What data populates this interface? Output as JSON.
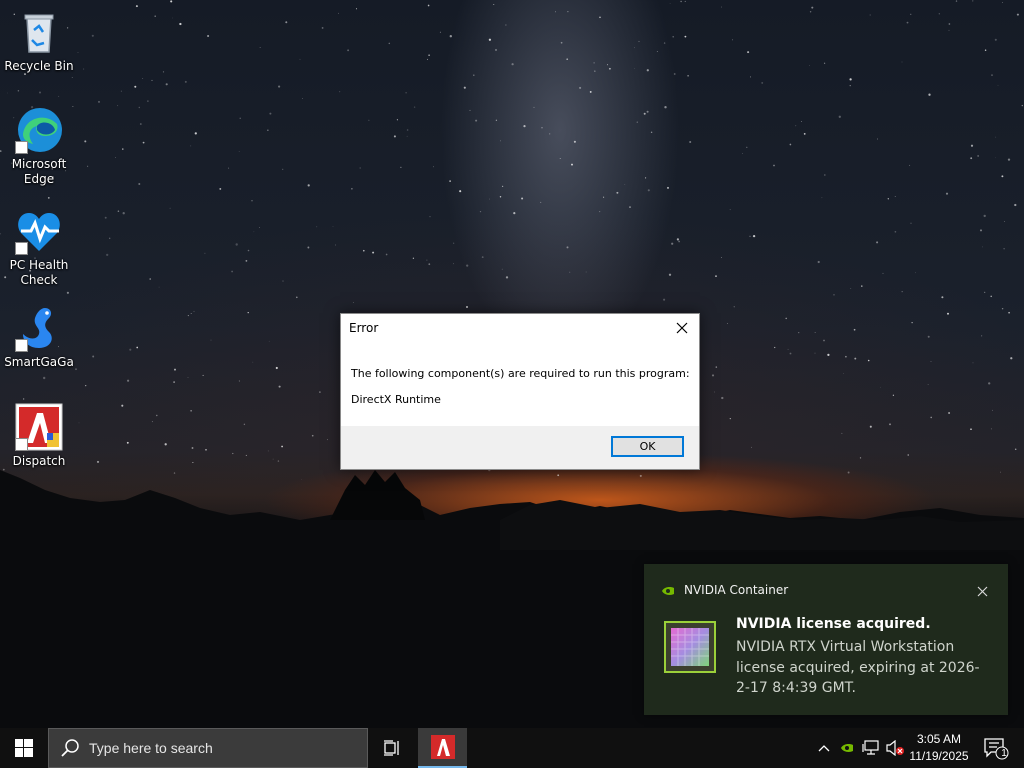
{
  "desktop": {
    "icons": [
      {
        "label": "Recycle Bin",
        "icon": "recycle-bin-icon"
      },
      {
        "label": "Microsoft Edge",
        "icon": "edge-icon"
      },
      {
        "label": "PC Health Check",
        "icon": "pc-health-check-icon"
      },
      {
        "label": "SmartGaGa",
        "icon": "smartgaga-icon"
      },
      {
        "label": "Dispatch",
        "icon": "dispatch-icon"
      }
    ]
  },
  "dialog": {
    "title": "Error",
    "message": "The following component(s) are required to run this program:",
    "component": "DirectX Runtime",
    "ok_label": "OK"
  },
  "notification": {
    "app_name": "NVIDIA Container",
    "heading": "NVIDIA license acquired.",
    "body": "NVIDIA RTX Virtual Workstation license acquired, expiring at 2026-2-17 8:4:39 GMT."
  },
  "taskbar": {
    "search_placeholder": "Type here to search",
    "time": "3:05 AM",
    "date": "11/19/2025",
    "notification_count": "1"
  },
  "colors": {
    "accent": "#0078d7",
    "nvidia_green": "#76b900",
    "toast_bg": "#1f2a1c",
    "taskbar_bg": "#101010"
  }
}
